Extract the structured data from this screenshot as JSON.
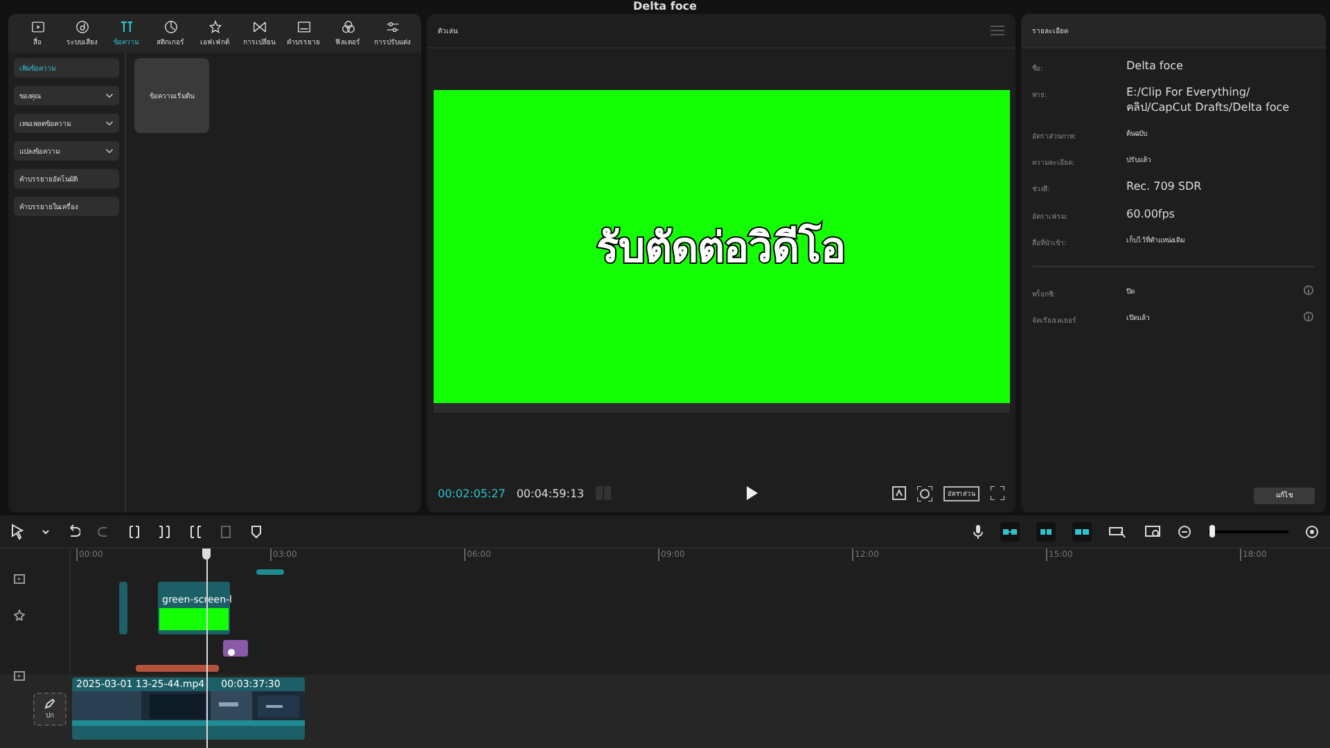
{
  "window": {
    "title": "Delta foce"
  },
  "media_panel": {
    "tabs": [
      {
        "label": "สื่อ",
        "selected": false
      },
      {
        "label": "ระบบเสียง",
        "selected": false
      },
      {
        "label": "ข้อความ",
        "selected": true
      },
      {
        "label": "สติกเกอร์",
        "selected": false
      },
      {
        "label": "เอฟเฟกต์",
        "selected": false
      },
      {
        "label": "การเปลี่ยน",
        "selected": false
      },
      {
        "label": "คำบรรยาย",
        "selected": false
      },
      {
        "label": "ฟิลเตอร์",
        "selected": false
      },
      {
        "label": "การปรับแต่ง",
        "selected": false
      }
    ],
    "sidebar": [
      {
        "label": "เพิ่มข้อความ",
        "kind": "button",
        "selected": true
      },
      {
        "label": "ของคุณ",
        "kind": "dropdown",
        "selected": false
      },
      {
        "label": "เทมเพลตข้อความ",
        "kind": "dropdown",
        "selected": false
      },
      {
        "label": "แปลงข้อความ",
        "kind": "dropdown",
        "selected": false
      },
      {
        "label": "คำบรรยายอัตโนมัติ",
        "kind": "button",
        "selected": false
      },
      {
        "label": "คำบรรยายในเครื่อง",
        "kind": "button",
        "selected": false
      }
    ],
    "cards": [
      {
        "label": "ข้อความเริ่มต้น"
      }
    ]
  },
  "player": {
    "title": "ตัวเล่น",
    "overlay_text": "รับตัดต่อวิดีโอ",
    "current_time": "00:02:05:27",
    "total_time": "00:04:59:13",
    "ratio_button": "อัตราส่วน"
  },
  "details": {
    "title": "รายละเอียด",
    "rows": [
      {
        "label": "ชื่อ:",
        "value": "Delta foce"
      },
      {
        "label": "พาธ:",
        "value": "E:/Clip For Everything/คลิป/CapCut Drafts/Delta foce"
      },
      {
        "label": "อัตราส่วนภาพ:",
        "value": "ต้นฉบับ"
      },
      {
        "label": "ความละเอียด:",
        "value": "ปรับแล้ว"
      },
      {
        "label": "ช่วงสี:",
        "value": "Rec. 709 SDR"
      },
      {
        "label": "อัตราเฟรม:",
        "value": "60.00fps"
      },
      {
        "label": "สื่อที่นำเข้า:",
        "value": "เก็บไว้ที่ตำแหน่งเดิม"
      }
    ],
    "settings": [
      {
        "label": "พร็อกซี:",
        "value": "ปิด"
      },
      {
        "label": "จัดเรียงเลเยอร์",
        "value": "เปิดแล้ว"
      }
    ],
    "edit_button": "แก้ไข"
  },
  "timeline": {
    "ruler": [
      "00:00",
      "03:00",
      "06:00",
      "09:00",
      "12:00",
      "15:00",
      "18:00"
    ],
    "zoom": {
      "level": 0.05
    },
    "text_clip": {
      "name": "green-screen-l"
    },
    "main_clip": {
      "name": "2025-03-01 13-25-44.mp4",
      "duration": "00:03:37:30"
    },
    "cover_label": "ปก"
  }
}
